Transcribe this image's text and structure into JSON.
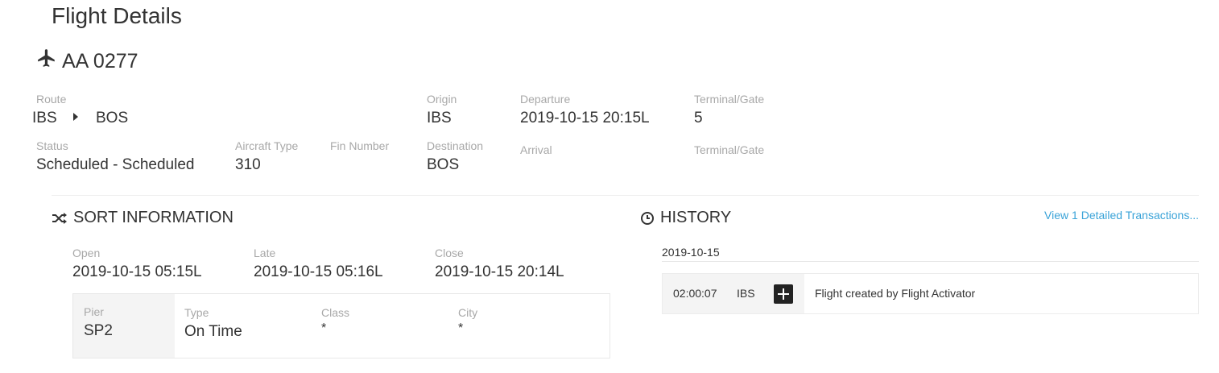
{
  "page": {
    "title": "Flight Details"
  },
  "flight": {
    "icon": "airplane-icon",
    "number": "AA 0277"
  },
  "details": {
    "route_label": "Route",
    "route_from": "IBS",
    "route_arrow_icon": "caret-right-icon",
    "route_to": "BOS",
    "origin_label": "Origin",
    "origin_value": "IBS",
    "departure_label": "Departure",
    "departure_value": "2019-10-15 20:15L",
    "dep_terminal_label": "Terminal/Gate",
    "dep_terminal_value": "5",
    "status_label": "Status",
    "status_value": "Scheduled - Scheduled",
    "aircraft_type_label": "Aircraft Type",
    "aircraft_type_value": "310",
    "fin_label": "Fin Number",
    "destination_label": "Destination",
    "destination_value": "BOS",
    "arrival_label": "Arrival",
    "arr_terminal_label": "Terminal/Gate"
  },
  "sort": {
    "icon": "shuffle-icon",
    "title": "SORT INFORMATION",
    "open_label": "Open",
    "open_value": "2019-10-15 05:15L",
    "late_label": "Late",
    "late_value": "2019-10-15 05:16L",
    "close_label": "Close",
    "close_value": "2019-10-15 20:14L",
    "pier_label": "Pier",
    "pier_value": "SP2",
    "type_label": "Type",
    "type_value": "On Time",
    "class_label": "Class",
    "class_value": "*",
    "city_label": "City",
    "city_value": "*"
  },
  "history": {
    "icon": "clock-icon",
    "title": "HISTORY",
    "link": "View 1 Detailed Transactions...",
    "date": "2019-10-15",
    "entries": [
      {
        "time": "02:00:07",
        "location": "IBS",
        "expand_icon": "plus-square-icon",
        "description": "Flight created by Flight Activator"
      }
    ]
  }
}
